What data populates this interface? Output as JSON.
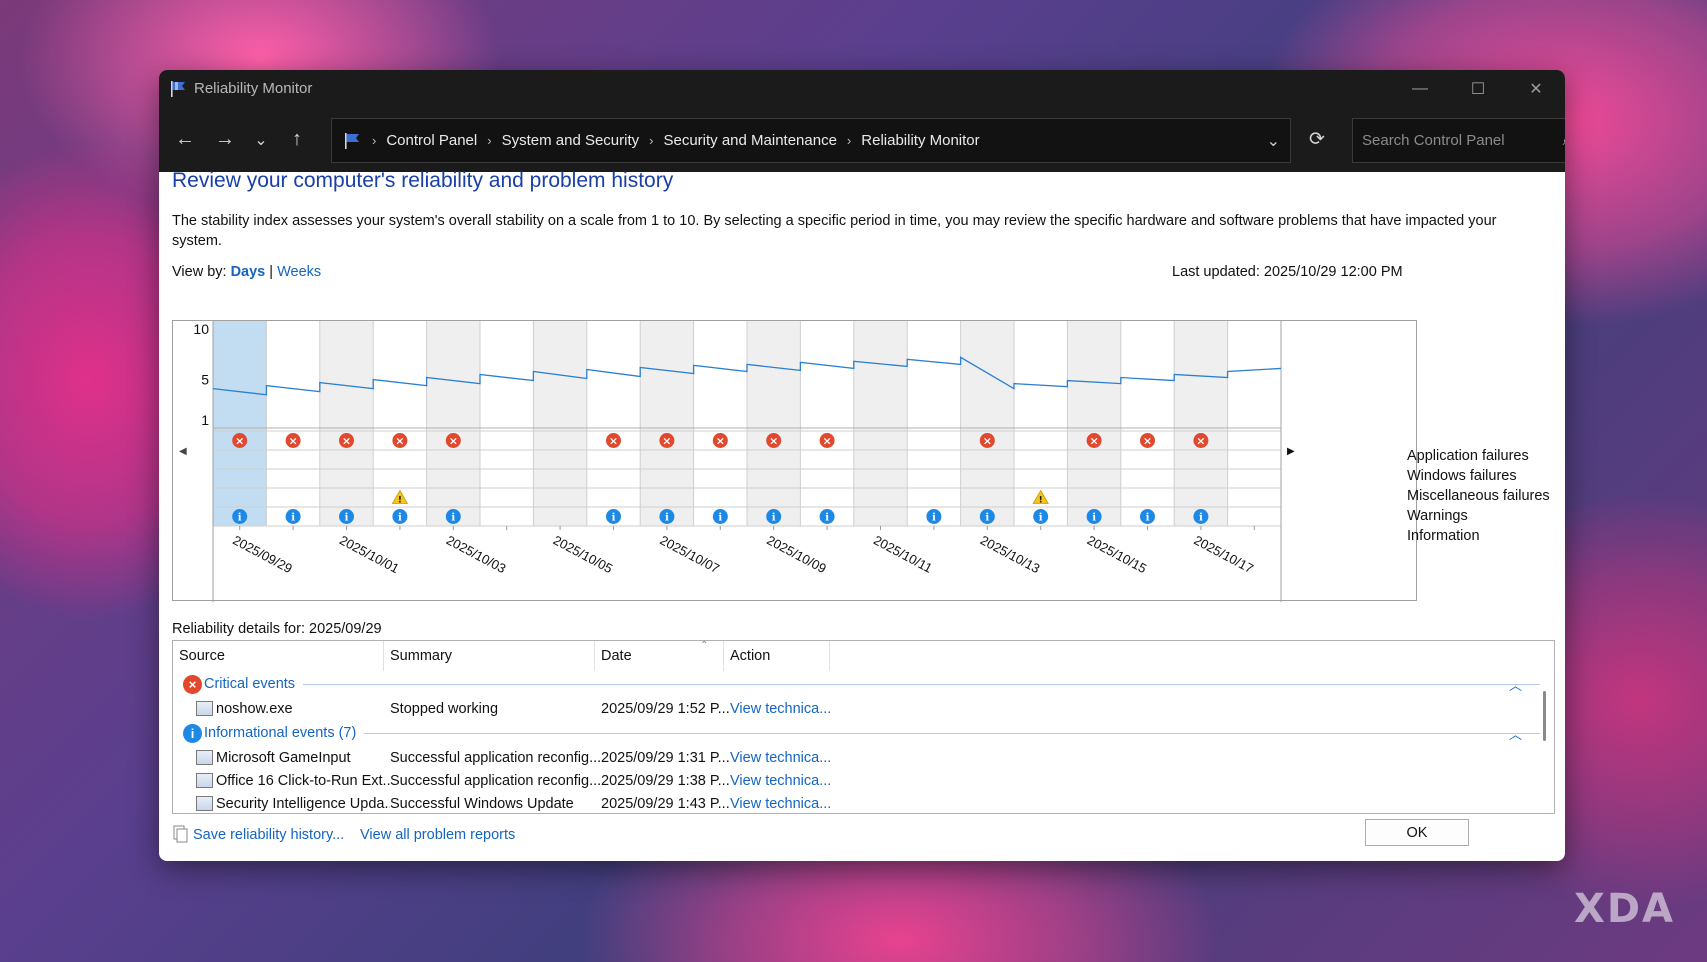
{
  "window": {
    "title": "Reliability Monitor",
    "controls": {
      "minimize": "—",
      "maximize": "☐",
      "close": "✕"
    }
  },
  "nav": {
    "back": "←",
    "forward": "→",
    "recent": "⌄",
    "up": "↑",
    "breadcrumbs": [
      "Control Panel",
      "System and Security",
      "Security and Maintenance",
      "Reliability Monitor"
    ],
    "search_placeholder": "Search Control Panel"
  },
  "page": {
    "heading": "Review your computer's reliability and problem history",
    "description": "The stability index assesses your system's overall stability on a scale from 1 to 10. By selecting a specific period in time, you may review the specific hardware and software problems that have impacted your system.",
    "view_by_label": "View by:",
    "view_days": "Days",
    "view_separator": "|",
    "view_weeks": "Weeks",
    "last_updated": "Last updated: 2025/10/29 12:00 PM"
  },
  "chart_data": {
    "type": "line",
    "y_ticks": [
      "10",
      "5",
      "1"
    ],
    "ylim": [
      1,
      10
    ],
    "x_tick_labels": [
      "2025/09/29",
      "2025/10/01",
      "2025/10/03",
      "2025/10/05",
      "2025/10/07",
      "2025/10/09",
      "2025/10/11",
      "2025/10/13",
      "2025/10/15",
      "2025/10/17"
    ],
    "days": [
      "09/29",
      "09/30",
      "10/01",
      "10/02",
      "10/03",
      "10/04",
      "10/05",
      "10/06",
      "10/07",
      "10/08",
      "10/09",
      "10/10",
      "10/11",
      "10/12",
      "10/13",
      "10/14",
      "10/15",
      "10/16",
      "10/17",
      "10/18"
    ],
    "stability_index": [
      [
        4.1,
        3.5
      ],
      [
        4.4,
        3.8
      ],
      [
        4.7,
        4.1
      ],
      [
        5.0,
        4.4
      ],
      [
        5.2,
        4.6
      ],
      [
        5.5,
        4.9
      ],
      [
        5.8,
        5.1
      ],
      [
        6.0,
        5.3
      ],
      [
        6.2,
        5.6
      ],
      [
        6.4,
        5.8
      ],
      [
        6.5,
        5.9
      ],
      [
        6.7,
        6.1
      ],
      [
        6.8,
        6.3
      ],
      [
        7.0,
        6.5
      ],
      [
        7.2,
        4.1
      ],
      [
        4.6,
        4.3
      ],
      [
        4.9,
        4.6
      ],
      [
        5.2,
        4.9
      ],
      [
        5.5,
        5.2
      ],
      [
        5.8,
        6.1
      ]
    ],
    "selected_day": 0,
    "rows": [
      "Application failures",
      "Windows failures",
      "Miscellaneous failures",
      "Warnings",
      "Information"
    ],
    "application_failures_days": [
      0,
      1,
      2,
      3,
      4,
      7,
      8,
      9,
      10,
      11,
      14,
      16,
      17,
      18
    ],
    "warnings_days": [
      3,
      15
    ],
    "information_days": [
      0,
      1,
      2,
      3,
      4,
      7,
      8,
      9,
      10,
      11,
      13,
      14,
      15,
      16,
      17,
      18
    ],
    "nav_left": "◀",
    "nav_right": "▶"
  },
  "details": {
    "label": "Reliability details for: 2025/09/29",
    "columns": [
      "Source",
      "Summary",
      "Date",
      "Action"
    ],
    "groups": [
      {
        "label": "Critical events",
        "icon": "×",
        "rows": [
          {
            "source": "noshow.exe",
            "summary": "Stopped working",
            "date": "2025/09/29 1:52 P...",
            "action": "View technica..."
          }
        ]
      },
      {
        "label": "Informational events (7)",
        "icon": "i",
        "rows": [
          {
            "source": "Microsoft GameInput",
            "summary": "Successful application reconfig...",
            "date": "2025/09/29 1:31 P...",
            "action": "View technica..."
          },
          {
            "source": "Office 16 Click-to-Run Ext...",
            "summary": "Successful application reconfig...",
            "date": "2025/09/29 1:38 P...",
            "action": "View technica..."
          },
          {
            "source": "Security Intelligence Upda...",
            "summary": "Successful Windows Update",
            "date": "2025/09/29 1:43 P...",
            "action": "View technica..."
          }
        ]
      }
    ]
  },
  "footer": {
    "save_history": "Save reliability history...",
    "view_all": "View all problem reports",
    "ok": "OK"
  },
  "watermark": "XDA",
  "colors": {
    "accent": "#1565c0",
    "heading": "#1a3fa6",
    "error": "#e0492e",
    "info": "#1e88e5",
    "warning": "#f5c518",
    "line": "#2a7fd1"
  }
}
